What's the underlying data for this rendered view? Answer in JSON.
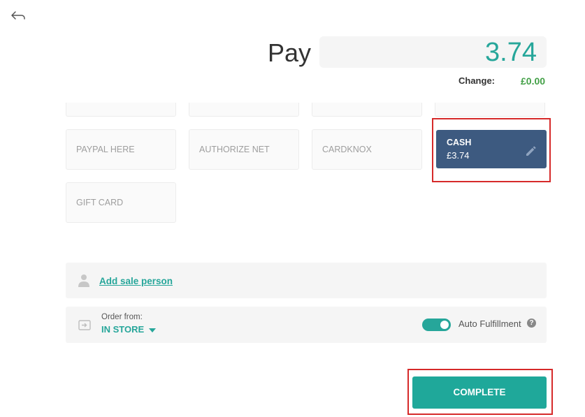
{
  "header": {
    "back_icon": "back-arrow-icon"
  },
  "pay": {
    "label": "Pay",
    "amount": "3.74"
  },
  "change": {
    "label": "Change:",
    "value": "£0.00"
  },
  "payment_methods": {
    "row1_partial": [
      "",
      "",
      "",
      ""
    ],
    "tiles": [
      "PAYPAL HERE",
      "AUTHORIZE NET",
      "CARDKNOX"
    ],
    "gift": "GIFT CARD",
    "cash": {
      "name": "CASH",
      "amount": "£3.74",
      "edit_icon": "pencil-icon"
    }
  },
  "sale_person": {
    "icon": "person-icon",
    "link": "Add sale person"
  },
  "order": {
    "icon": "store-icon",
    "label": "Order from:",
    "value": "IN STORE",
    "auto_fulfillment_label": "Auto Fulfillment",
    "auto_fulfillment_on": true,
    "help_icon": "help-icon"
  },
  "complete_button": "COMPLETE",
  "colors": {
    "accent": "#26a69a",
    "cash_tile": "#3d5a80",
    "change_green": "#43a047",
    "highlight": "#d62a2a"
  }
}
